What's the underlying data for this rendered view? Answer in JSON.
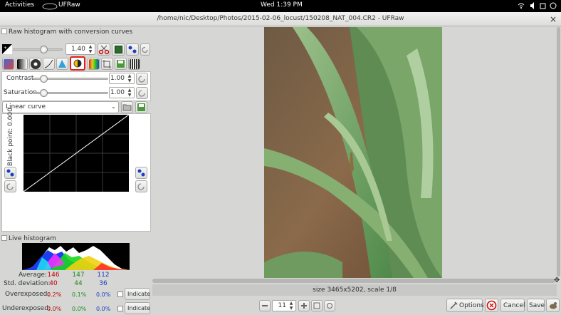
{
  "topbar": {
    "activities": "Activities",
    "app_name": "UFRaw",
    "clock": "Wed  1:39 PM"
  },
  "window": {
    "title": "/home/nic/Desktop/Photos/2015-02-06_locust/150208_NAT_004.CR2 - UFRaw",
    "close_glyph": "×"
  },
  "raw_histogram": {
    "label": "Raw histogram with conversion curves",
    "exposure_value": "1.40"
  },
  "adjust": {
    "contrast_label": "Contrast",
    "contrast_value": "1.00",
    "saturation_label": "Saturation",
    "saturation_value": "1.00"
  },
  "curve": {
    "preset": "Linear curve",
    "black_point_label": "Black point: 0.000"
  },
  "live_histogram": {
    "label": "Live histogram",
    "average_label": "Average:",
    "average": [
      "146",
      "147",
      "112"
    ],
    "std_label": "Std. deviation:",
    "std": [
      "40",
      "44",
      "36"
    ],
    "over_label": "Overexposed:",
    "over": [
      "0.2%",
      "0.1%",
      "0.0%"
    ],
    "under_label": "Underexposed:",
    "under": [
      "0.0%",
      "0.0%",
      "0.0%"
    ],
    "indicate_label": "Indicate"
  },
  "status": {
    "size_text": "size 3465x5202, scale 1/8"
  },
  "zoom": {
    "value": "11"
  },
  "buttons": {
    "options": "Options",
    "cancel": "Cancel",
    "save": "Save"
  },
  "colors": {
    "highlight": "#e0201c",
    "avg_red": "#c00000",
    "avg_green": "#1a8a1a",
    "avg_blue": "#1a3ec0"
  }
}
